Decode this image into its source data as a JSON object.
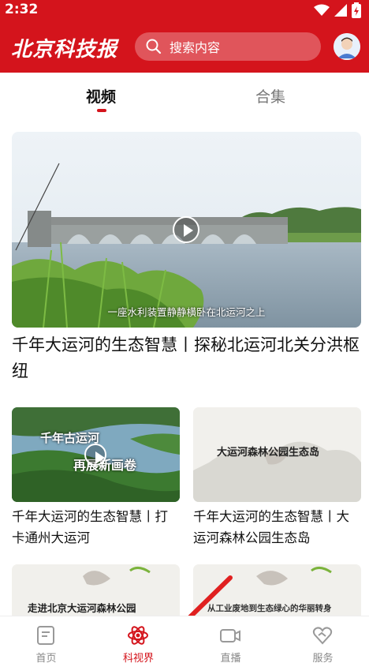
{
  "status": {
    "time": "2:32"
  },
  "header": {
    "logo_text": "北京科技报",
    "search_placeholder": "搜索内容"
  },
  "tabs": [
    {
      "label": "视频",
      "active": true
    },
    {
      "label": "合集",
      "active": false
    }
  ],
  "featured": {
    "caption": "一座水利装置静静横卧在北运河之上",
    "title": "千年大运河的生态智慧丨探秘北运河北关分洪枢纽"
  },
  "cards": [
    {
      "overlay_line1": "千年古运河",
      "overlay_line2": "再展新画卷",
      "title": "千年大运河的生态智慧丨打卡通州大运河"
    },
    {
      "overlay_line1": "大运河森林公园生态岛",
      "title": "千年大运河的生态智慧丨大运河森林公园生态岛"
    },
    {
      "overlay_line1": "走进北京大运河森林公园",
      "title": ""
    },
    {
      "overlay_line1": "从工业废地到生态绿心的华丽转身",
      "title": ""
    }
  ],
  "bottom_nav": [
    {
      "label": "首页",
      "icon": "document-icon",
      "active": false
    },
    {
      "label": "科视界",
      "icon": "atom-icon",
      "active": true
    },
    {
      "label": "直播",
      "icon": "video-camera-icon",
      "active": false
    },
    {
      "label": "服务",
      "icon": "heart-service-icon",
      "active": false
    }
  ],
  "colors": {
    "brand_red": "#d4141c",
    "nav_inactive": "#888888"
  }
}
